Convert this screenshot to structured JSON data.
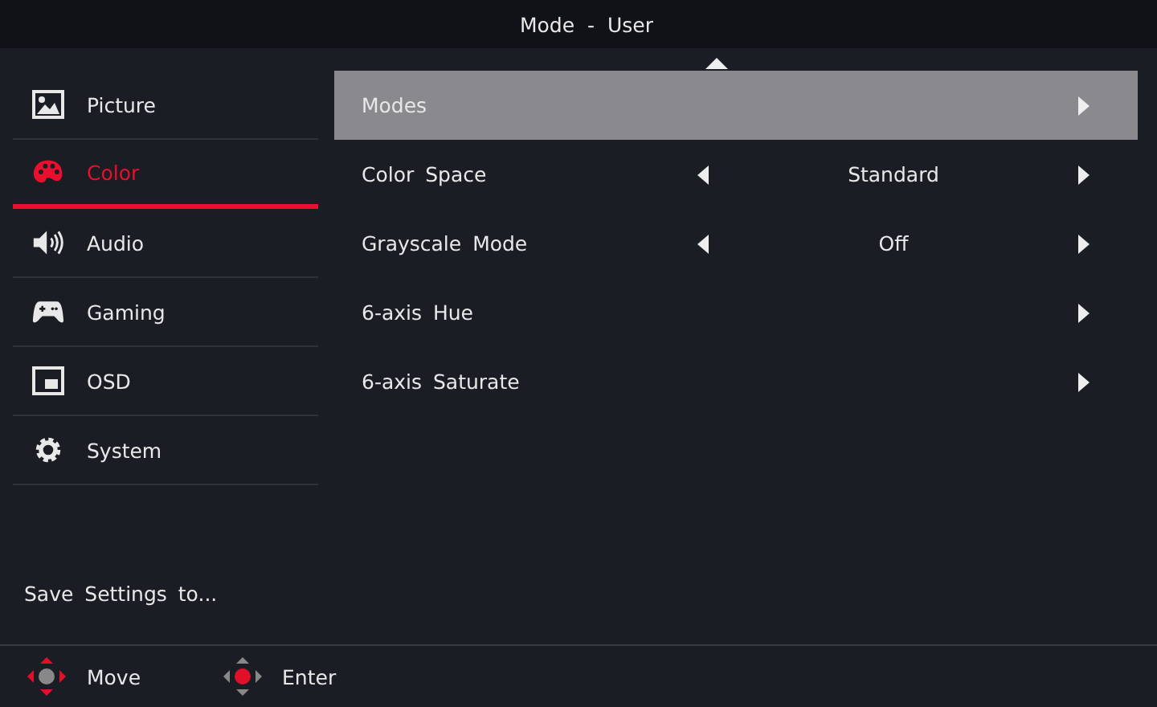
{
  "header": {
    "title": "Mode - User"
  },
  "sidebar": {
    "items": [
      {
        "label": "Picture",
        "selected": false
      },
      {
        "label": "Color",
        "selected": true
      },
      {
        "label": "Audio",
        "selected": false
      },
      {
        "label": "Gaming",
        "selected": false
      },
      {
        "label": "OSD",
        "selected": false
      },
      {
        "label": "System",
        "selected": false
      }
    ],
    "save_settings": "Save Settings to..."
  },
  "menu": {
    "rows": [
      {
        "label": "Modes",
        "selected": true
      },
      {
        "label": "Color Space",
        "value": "Standard",
        "selected": false
      },
      {
        "label": "Grayscale Mode",
        "value": "Off",
        "selected": false
      },
      {
        "label": "6-axis Hue",
        "selected": false
      },
      {
        "label": "6-axis Saturate",
        "selected": false
      }
    ]
  },
  "footer": {
    "hints": [
      {
        "label": "Move"
      },
      {
        "label": "Enter"
      }
    ]
  }
}
